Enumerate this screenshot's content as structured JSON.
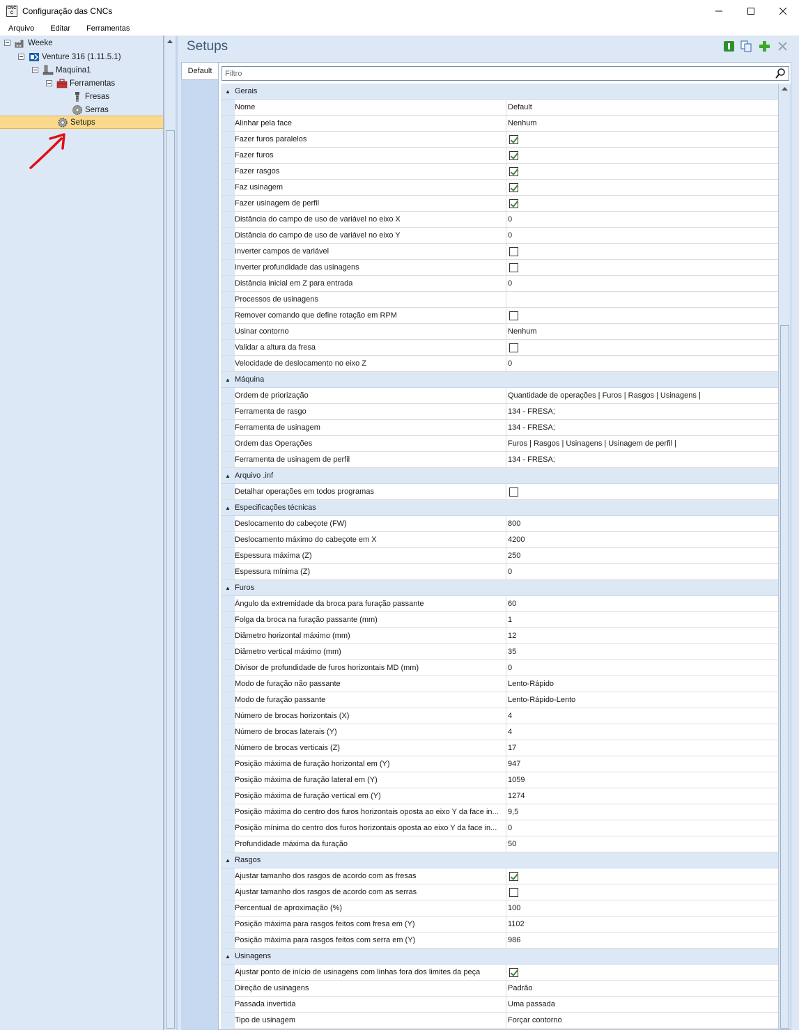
{
  "window": {
    "title": "Configuração das CNCs",
    "icon_text_top": "CNC",
    "icon_text_bottom": "C"
  },
  "menu": [
    "Arquivo",
    "Editar",
    "Ferramentas"
  ],
  "tree": {
    "items": [
      {
        "label": "Weeke",
        "level": 0,
        "icon": "factory-icon"
      },
      {
        "label": "Venture 316 (1.11.5.1)",
        "level": 1,
        "icon": "cnc-machine-icon"
      },
      {
        "label": "Maquina1",
        "level": 2,
        "icon": "machine-icon"
      },
      {
        "label": "Ferramentas",
        "level": 3,
        "icon": "toolbox-icon"
      },
      {
        "label": "Fresas",
        "level": 4,
        "icon": "mill-bit-icon"
      },
      {
        "label": "Serras",
        "level": 4,
        "icon": "saw-blade-icon"
      },
      {
        "label": "Setups",
        "level": 3,
        "icon": "gear-icon",
        "selected": true
      }
    ]
  },
  "panel": {
    "title": "Setups",
    "tab": "Default",
    "filter_placeholder": "Filtro"
  },
  "colors": {
    "accent": "#3d5777",
    "selection": "#fbd98a",
    "panel_bg": "#dce8f6",
    "check": "#3a8a3a",
    "annotation_arrow": "#e01010"
  },
  "properties": [
    {
      "category": "Gerais",
      "rows": [
        {
          "name": "Nome",
          "value": "Default"
        },
        {
          "name": "Alinhar pela face",
          "value": "Nenhum"
        },
        {
          "name": "Fazer furos paralelos",
          "check": true
        },
        {
          "name": "Fazer furos",
          "check": true
        },
        {
          "name": "Fazer rasgos",
          "check": true
        },
        {
          "name": "Faz usinagem",
          "check": true
        },
        {
          "name": "Fazer usinagem de perfil",
          "check": true
        },
        {
          "name": "Distância do campo de uso de variável no eixo X",
          "value": "0"
        },
        {
          "name": "Distância do campo de uso de variável no eixo Y",
          "value": "0"
        },
        {
          "name": "Inverter campos de variável",
          "check": false
        },
        {
          "name": "Inverter profundidade das usinagens",
          "check": false
        },
        {
          "name": "Distância inicial em Z para entrada",
          "value": "0"
        },
        {
          "name": "Processos de usinagens",
          "value": ""
        },
        {
          "name": "Remover comando que define rotação em RPM",
          "check": false
        },
        {
          "name": "Usinar contorno",
          "value": "Nenhum"
        },
        {
          "name": "Validar a altura da fresa",
          "check": false
        },
        {
          "name": "Velocidade de deslocamento no eixo Z",
          "value": "0"
        }
      ]
    },
    {
      "category": "Máquina",
      "rows": [
        {
          "name": "Ordem de priorização",
          "value": "Quantidade de operações | Furos | Rasgos | Usinagens |"
        },
        {
          "name": "Ferramenta de rasgo",
          "value": "134 - FRESA;"
        },
        {
          "name": "Ferramenta de usinagem",
          "value": "134 - FRESA;"
        },
        {
          "name": "Ordem das Operações",
          "value": "Furos | Rasgos | Usinagens | Usinagem de perfil |"
        },
        {
          "name": "Ferramenta de usinagem de perfil",
          "value": "134 - FRESA;"
        }
      ]
    },
    {
      "category": "Arquivo .inf",
      "rows": [
        {
          "name": "Detalhar operações em todos programas",
          "check": false
        }
      ]
    },
    {
      "category": "Especificações técnicas",
      "rows": [
        {
          "name": "Deslocamento do cabeçote (FW)",
          "value": "800"
        },
        {
          "name": "Deslocamento máximo do cabeçote em X",
          "value": "4200"
        },
        {
          "name": "Espessura máxima (Z)",
          "value": "250"
        },
        {
          "name": "Espessura mínima (Z)",
          "value": "0"
        }
      ]
    },
    {
      "category": "Furos",
      "rows": [
        {
          "name": "Ângulo da extremidade da broca para furação passante",
          "value": "60"
        },
        {
          "name": "Folga da broca na furação passante (mm)",
          "value": "1"
        },
        {
          "name": "Diâmetro horizontal máximo (mm)",
          "value": "12"
        },
        {
          "name": "Diâmetro vertical máximo (mm)",
          "value": "35"
        },
        {
          "name": "Divisor de profundidade de furos horizontais MD (mm)",
          "value": "0"
        },
        {
          "name": "Modo de furação não passante",
          "value": "Lento-Rápido"
        },
        {
          "name": "Modo de furação passante",
          "value": "Lento-Rápido-Lento"
        },
        {
          "name": "Número de brocas horizontais (X)",
          "value": "4"
        },
        {
          "name": "Número de brocas laterais (Y)",
          "value": "4"
        },
        {
          "name": "Número de brocas verticais (Z)",
          "value": "17"
        },
        {
          "name": "Posição máxima de furação horizontal em (Y)",
          "value": "947"
        },
        {
          "name": "Posição máxima de furação lateral em (Y)",
          "value": "1059"
        },
        {
          "name": "Posição máxima de furação vertical em (Y)",
          "value": "1274"
        },
        {
          "name": "Posição máxima do centro dos furos horizontais oposta ao eixo Y da face in...",
          "value": "9,5"
        },
        {
          "name": "Posição mínima do centro dos furos horizontais oposta ao eixo Y da face in...",
          "value": "0"
        },
        {
          "name": "Profundidade máxima da furação",
          "value": "50"
        }
      ]
    },
    {
      "category": "Rasgos",
      "rows": [
        {
          "name": "Ajustar tamanho dos rasgos de acordo com as fresas",
          "check": true
        },
        {
          "name": "Ajustar tamanho dos rasgos de acordo com as serras",
          "check": false
        },
        {
          "name": "Percentual de aproximação (%)",
          "value": "100"
        },
        {
          "name": "Posição máxima para rasgos feitos com fresa em (Y)",
          "value": "1102"
        },
        {
          "name": "Posição máxima para rasgos feitos com serra em (Y)",
          "value": "986"
        }
      ]
    },
    {
      "category": "Usinagens",
      "rows": [
        {
          "name": "Ajustar ponto de início de usinagens com linhas fora dos limites da peça",
          "check": true
        },
        {
          "name": "Direção de usinagens",
          "value": "Padrão"
        },
        {
          "name": "Passada invertida",
          "value": "Uma passada"
        },
        {
          "name": "Tipo de usinagem",
          "value": "Forçar contorno"
        }
      ]
    }
  ]
}
